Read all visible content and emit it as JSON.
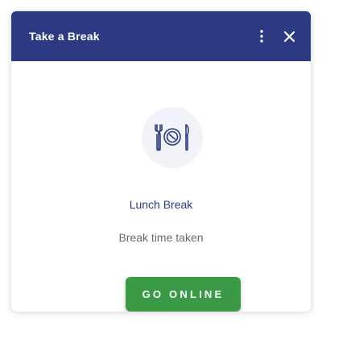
{
  "dialog": {
    "title": "Take a Break",
    "header_color": "#2b3a82",
    "menu_icon": "more-vertical-icon",
    "close_icon": "close-icon"
  },
  "content": {
    "icon": "utensils-plate-icon",
    "break_name": "Lunch Break",
    "status_text": "Break time taken"
  },
  "actions": {
    "go_online_label": "GO ONLINE",
    "go_online_color": "#3b9a45"
  }
}
